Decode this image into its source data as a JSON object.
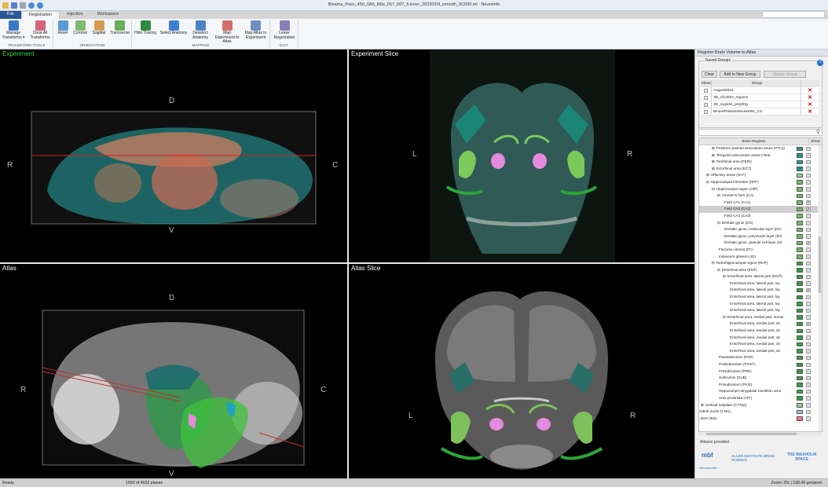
{
  "window": {
    "title": "Binama_Pass_450_0A0_N0o_057_007_5.inner_2023020l_smooth_9C000.ml - Neuroinfo"
  },
  "menu": {
    "file": "File",
    "tabs": [
      "Registration",
      "Injection",
      "Workspace"
    ]
  },
  "ribbon": {
    "groups": [
      {
        "label": "TRANSFORM TOOLS",
        "buttons": [
          "Manage Transforms ▾",
          "Clear All Transforms"
        ]
      },
      {
        "label": "ORIENTATION",
        "buttons": [
          "Reset",
          "Coronal",
          "Sagittal",
          "Transverse"
        ]
      },
      {
        "label": "MAPPING",
        "buttons": [
          "Hide Tracing",
          "Select Anatomy",
          "Deselect Anatomy",
          "Map Experiment to Atlas",
          "Map Atlas to Experiment"
        ]
      },
      {
        "label": "EXIT",
        "buttons": [
          "Leave Registration"
        ]
      }
    ]
  },
  "panels": {
    "experiment": {
      "label": "Experiment",
      "orient": [
        "D",
        "V",
        "R",
        "C"
      ]
    },
    "experiment_slice": {
      "label": "Experiment Slice",
      "orient": [
        "L",
        "R"
      ]
    },
    "atlas": {
      "label": "Atlas",
      "orient": [
        "D",
        "V",
        "R",
        "C"
      ]
    },
    "atlas_slice": {
      "label": "Atlas Slice",
      "orient": [
        "L",
        "R"
      ]
    }
  },
  "right_panel": {
    "title": "Register Brain Volume to Atlas",
    "saved_groups": {
      "title": "Saved Groups",
      "buttons": [
        "Clear",
        "Add to New Group",
        "Update Group"
      ],
      "headers": [
        "Show",
        "Group"
      ],
      "rows": [
        "August2022",
        "3D_nfv2022_regions",
        "3D_regions_prepfrtg",
        "BinarePassiveMouse001_CS"
      ]
    },
    "tree_headers": [
      "Brain Regions",
      "Show"
    ],
    "regions": [
      {
        "name": "Posterior parietal association areas (PTLp)",
        "indent": 2,
        "exp": "⊞",
        "color": "#1a9a8e",
        "checked": false,
        "sel": false
      },
      {
        "name": "Temporal association areas (TEa)",
        "indent": 2,
        "exp": "⊞",
        "color": "#1a9a8e",
        "checked": false,
        "sel": false
      },
      {
        "name": "Perirhinal area (PERI)",
        "indent": 2,
        "exp": "⊞",
        "color": "#1a9a8e",
        "checked": false,
        "sel": false
      },
      {
        "name": "Ectorhinal area (ECT)",
        "indent": 2,
        "exp": "⊞",
        "color": "#1a9a8e",
        "checked": false,
        "sel": false
      },
      {
        "name": "Olfactory areas (OLF)",
        "indent": 1,
        "exp": "⊞",
        "color": "#8ed29c",
        "checked": false,
        "sel": false
      },
      {
        "name": "Hippocampal formation (HPF)",
        "indent": 1,
        "exp": "⊟",
        "color": "#6ec05e",
        "checked": false,
        "sel": false
      },
      {
        "name": "Hippocampal region (HIP)",
        "indent": 2,
        "exp": "⊟",
        "color": "#6ec05e",
        "checked": false,
        "sel": false
      },
      {
        "name": "Ammon's horn (CA)",
        "indent": 3,
        "exp": "⊟",
        "color": "#6ec05e",
        "checked": false,
        "sel": false
      },
      {
        "name": "Field CA1 (CA1)",
        "indent": 4,
        "exp": "",
        "color": "#6ec05e",
        "checked": true,
        "sel": false
      },
      {
        "name": "Field CA2 (CA2)",
        "indent": 4,
        "exp": "",
        "color": "#6ec05e",
        "checked": true,
        "sel": true
      },
      {
        "name": "Field CA3 (CA3)",
        "indent": 4,
        "exp": "",
        "color": "#6ec05e",
        "checked": false,
        "sel": false
      },
      {
        "name": "Dentate gyrus (DG)",
        "indent": 3,
        "exp": "⊟",
        "color": "#6ec05e",
        "checked": false,
        "sel": false
      },
      {
        "name": "Dentate gyrus, molecular layer (DG-",
        "indent": 4,
        "exp": "",
        "color": "#6ec05e",
        "checked": false,
        "sel": false
      },
      {
        "name": "Dentate gyrus, polymorph layer (DG",
        "indent": 4,
        "exp": "",
        "color": "#6ec05e",
        "checked": false,
        "sel": false
      },
      {
        "name": "Dentate gyrus, granule cell layer (D(",
        "indent": 4,
        "exp": "",
        "color": "#6ec05e",
        "checked": true,
        "sel": false
      },
      {
        "name": "Fasciola cinerea (FC)",
        "indent": 3,
        "exp": "",
        "color": "#6ec05e",
        "checked": false,
        "sel": false
      },
      {
        "name": "Induseum griseum (IG)",
        "indent": 3,
        "exp": "",
        "color": "#6ec05e",
        "checked": false,
        "sel": false
      },
      {
        "name": "Retrohippocampal region (RHP)",
        "indent": 2,
        "exp": "⊟",
        "color": "#2ca53a",
        "checked": false,
        "sel": false
      },
      {
        "name": "Entorhinal area (ENT)",
        "indent": 3,
        "exp": "⊟",
        "color": "#2ca53a",
        "checked": false,
        "sel": false
      },
      {
        "name": "Entorhinal area, lateral part (ENTl)",
        "indent": 4,
        "exp": "⊟",
        "color": "#2ca53a",
        "checked": false,
        "sel": false
      },
      {
        "name": "Entorhinal area, lateral part, lay",
        "indent": 5,
        "exp": "",
        "color": "#2ca53a",
        "checked": false,
        "sel": false
      },
      {
        "name": "Entorhinal area, lateral part, lay",
        "indent": 5,
        "exp": "",
        "color": "#2ca53a",
        "checked": true,
        "sel": false
      },
      {
        "name": "Entorhinal area, lateral part, lay",
        "indent": 5,
        "exp": "",
        "color": "#2ca53a",
        "checked": false,
        "sel": false
      },
      {
        "name": "Entorhinal area, lateral part, lay",
        "indent": 5,
        "exp": "",
        "color": "#2ca53a",
        "checked": false,
        "sel": false
      },
      {
        "name": "Entorhinal area, lateral part, lay",
        "indent": 5,
        "exp": "",
        "color": "#2ca53a",
        "checked": false,
        "sel": false
      },
      {
        "name": "Entorhinal area, medial part, dorsal",
        "indent": 4,
        "exp": "⊟",
        "color": "#2ca53a",
        "checked": false,
        "sel": false
      },
      {
        "name": "Entorhinal area, medial part, do",
        "indent": 5,
        "exp": "",
        "color": "#2ca53a",
        "checked": true,
        "sel": false
      },
      {
        "name": "Entorhinal area, medial part, do",
        "indent": 5,
        "exp": "",
        "color": "#2ca53a",
        "checked": false,
        "sel": false
      },
      {
        "name": "Entorhinal area, medial part, do",
        "indent": 5,
        "exp": "",
        "color": "#2ca53a",
        "checked": false,
        "sel": false
      },
      {
        "name": "Entorhinal area, medial part, do",
        "indent": 5,
        "exp": "",
        "color": "#2ca53a",
        "checked": false,
        "sel": false
      },
      {
        "name": "Entorhinal area, medial part, do",
        "indent": 5,
        "exp": "",
        "color": "#2ca53a",
        "checked": false,
        "sel": false
      },
      {
        "name": "Parasubiculum (PAR)",
        "indent": 3,
        "exp": "",
        "color": "#2ca53a",
        "checked": false,
        "sel": false
      },
      {
        "name": "Postsubiculum (POST)",
        "indent": 3,
        "exp": "",
        "color": "#2ca53a",
        "checked": false,
        "sel": false
      },
      {
        "name": "Presubiculum (PRE)",
        "indent": 3,
        "exp": "",
        "color": "#2ca53a",
        "checked": false,
        "sel": false
      },
      {
        "name": "Subiculum (SUB)",
        "indent": 3,
        "exp": "",
        "color": "#2ca53a",
        "checked": false,
        "sel": false
      },
      {
        "name": "Prosubiculum (ProS)",
        "indent": 3,
        "exp": "",
        "color": "#2ca53a",
        "checked": false,
        "sel": false
      },
      {
        "name": "Hippocampo-amygdalar transition area",
        "indent": 3,
        "exp": "",
        "color": "#2ca53a",
        "checked": false,
        "sel": false
      },
      {
        "name": "Area prostriata (APr)",
        "indent": 3,
        "exp": "",
        "color": "#2ca53a",
        "checked": false,
        "sel": false
      },
      {
        "name": "Cortical subplate (CTXsp)",
        "indent": 0,
        "exp": "⊞",
        "color": "#8ed29c",
        "checked": false,
        "sel": false
      },
      {
        "name": "erebral nuclei (CNU)",
        "indent": -1,
        "exp": "",
        "color": "#9fc6e8",
        "checked": false,
        "sel": false
      },
      {
        "name": "n stem (BS)",
        "indent": -1,
        "exp": "",
        "color": "#ff7080",
        "checked": false,
        "sel": false
      }
    ],
    "atlases_label": "Atlases provided",
    "logos": [
      "mbf",
      "ALLEN INSTITUTE BRAIN SCIENCE",
      "THE WAXHOLM SPACE"
    ],
    "logo_sub": "Neurolucida/"
  },
  "status": {
    "left": "Ready",
    "center": "1650 of 4022 planes",
    "right": "Zoom: 5% | 198.40 µm/pixel"
  }
}
